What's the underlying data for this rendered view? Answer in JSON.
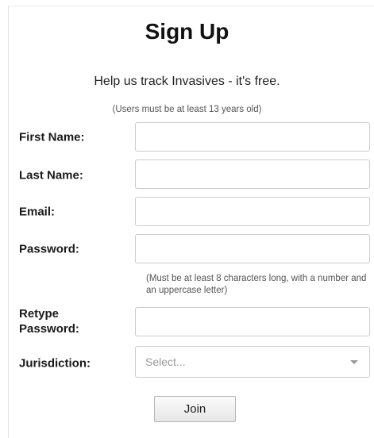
{
  "form": {
    "title": "Sign Up",
    "subtitle": "Help us track Invasives - it's free.",
    "age_note": "(Users must be at least 13 years old)",
    "fields": {
      "first_name": {
        "label": "First Name:",
        "value": "",
        "placeholder": ""
      },
      "last_name": {
        "label": "Last Name:",
        "value": "",
        "placeholder": ""
      },
      "email": {
        "label": "Email:",
        "value": "",
        "placeholder": ""
      },
      "password": {
        "label": "Password:",
        "value": "",
        "placeholder": ""
      },
      "retype_password": {
        "label_line1": "Retype",
        "label_line2": "Password:",
        "value": "",
        "placeholder": ""
      },
      "jurisdiction": {
        "label": "Jurisdiction:",
        "selected": "Select...",
        "icon": "chevron-down-icon"
      }
    },
    "password_note": "(Must be at least 8 characters long, with a number and an uppercase letter)",
    "join_label": "Join"
  },
  "colors": {
    "border": "#cccccc",
    "text": "#222222",
    "muted": "#555555",
    "placeholder": "#999999"
  }
}
